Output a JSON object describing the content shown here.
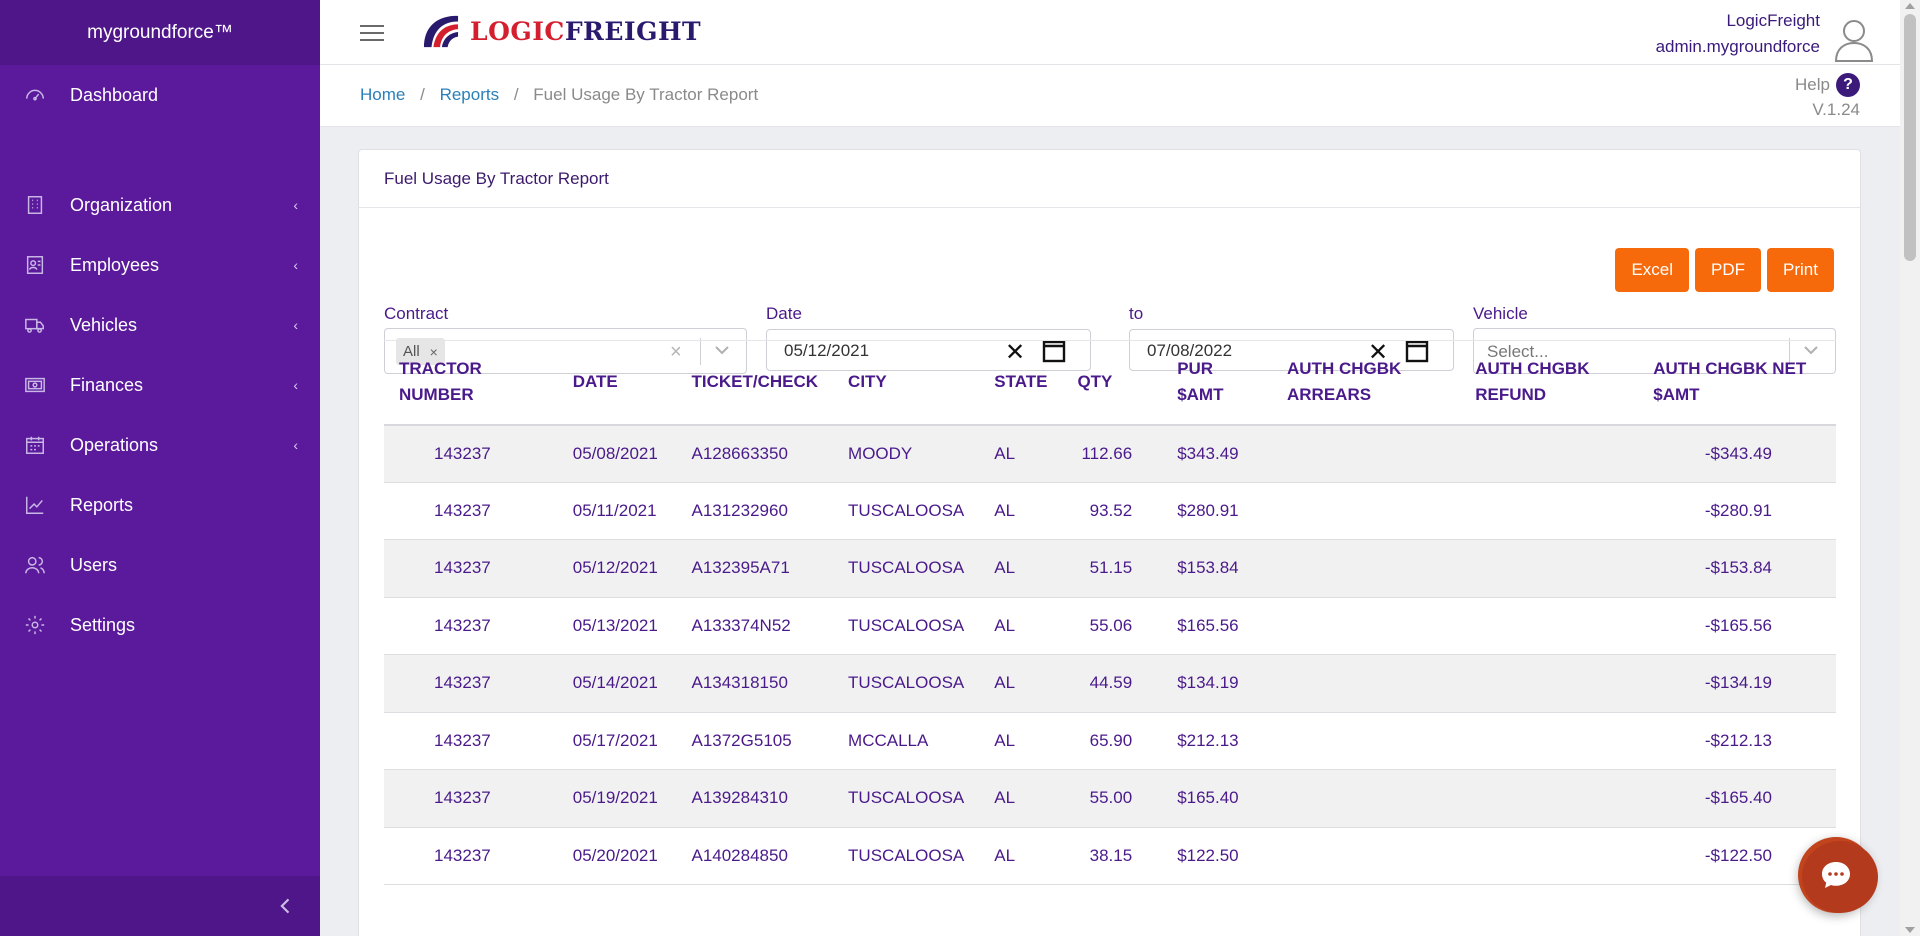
{
  "sidebar": {
    "brand": "mygroundforce™",
    "items": [
      {
        "label": "Dashboard",
        "icon": "dashboard-icon",
        "has_submenu": false
      },
      {
        "label": "Organization",
        "icon": "building-icon",
        "has_submenu": true
      },
      {
        "label": "Employees",
        "icon": "employee-badge-icon",
        "has_submenu": true
      },
      {
        "label": "Vehicles",
        "icon": "truck-icon",
        "has_submenu": true
      },
      {
        "label": "Finances",
        "icon": "money-icon",
        "has_submenu": true
      },
      {
        "label": "Operations",
        "icon": "calendar-icon",
        "has_submenu": true
      },
      {
        "label": "Reports",
        "icon": "chart-line-icon",
        "has_submenu": false
      },
      {
        "label": "Users",
        "icon": "users-icon",
        "has_submenu": false
      },
      {
        "label": "Settings",
        "icon": "gear-icon",
        "has_submenu": false
      }
    ],
    "chevron": "‹"
  },
  "header": {
    "logo_part1": "LOGIC",
    "logo_part2": "FREIGHT",
    "company": "LogicFreight",
    "username": "admin.mygroundforce"
  },
  "breadcrumb": {
    "home": "Home",
    "reports": "Reports",
    "current": "Fuel Usage By Tractor Report",
    "separator": "/"
  },
  "help": {
    "label": "Help",
    "icon": "?",
    "version": "V.1.24"
  },
  "card": {
    "title": "Fuel Usage By Tractor Report"
  },
  "export_buttons": {
    "excel": "Excel",
    "pdf": "PDF",
    "print": "Print"
  },
  "filters": {
    "contract_label": "Contract",
    "contract_tag": "All",
    "contract_tag_remove": "×",
    "clear": "×",
    "date_label": "Date",
    "date_from": "05/12/2021",
    "to_label": "to",
    "date_to": "07/08/2022",
    "date_clear": "✕",
    "vehicle_label": "Vehicle",
    "vehicle_placeholder": "Select..."
  },
  "table": {
    "columns": [
      {
        "l1": "TRACTOR",
        "l2": "NUMBER"
      },
      {
        "l1": "DATE",
        "l2": ""
      },
      {
        "l1": "TICKET/CHECK",
        "l2": ""
      },
      {
        "l1": "CITY",
        "l2": ""
      },
      {
        "l1": "STATE",
        "l2": ""
      },
      {
        "l1": "QTY",
        "l2": ""
      },
      {
        "l1": "PUR",
        "l2": "$AMT"
      },
      {
        "l1": "AUTH CHGBK",
        "l2": "ARREARS"
      },
      {
        "l1": "AUTH CHGBK",
        "l2": "REFUND"
      },
      {
        "l1": "AUTH CHGBK NET",
        "l2": "$AMT"
      }
    ],
    "rows": [
      [
        "143237",
        "05/08/2021",
        "A128663350",
        "MOODY",
        "AL",
        "112.66",
        "$343.49",
        "",
        "",
        "-$343.49"
      ],
      [
        "143237",
        "05/11/2021",
        "A131232960",
        "TUSCALOOSA",
        "AL",
        "93.52",
        "$280.91",
        "",
        "",
        "-$280.91"
      ],
      [
        "143237",
        "05/12/2021",
        "A132395A71",
        "TUSCALOOSA",
        "AL",
        "51.15",
        "$153.84",
        "",
        "",
        "-$153.84"
      ],
      [
        "143237",
        "05/13/2021",
        "A133374N52",
        "TUSCALOOSA",
        "AL",
        "55.06",
        "$165.56",
        "",
        "",
        "-$165.56"
      ],
      [
        "143237",
        "05/14/2021",
        "A134318150",
        "TUSCALOOSA",
        "AL",
        "44.59",
        "$134.19",
        "",
        "",
        "-$134.19"
      ],
      [
        "143237",
        "05/17/2021",
        "A1372G5105",
        "MCCALLA",
        "AL",
        "65.90",
        "$212.13",
        "",
        "",
        "-$212.13"
      ],
      [
        "143237",
        "05/19/2021",
        "A139284310",
        "TUSCALOOSA",
        "AL",
        "55.00",
        "$165.40",
        "",
        "",
        "-$165.40"
      ],
      [
        "143237",
        "05/20/2021",
        "A140284850",
        "TUSCALOOSA",
        "AL",
        "38.15",
        "$122.50",
        "",
        "",
        "-$122.50"
      ]
    ]
  },
  "colors": {
    "sidebar_bg": "#5b1a9c",
    "accent_text": "#4a1a8a",
    "button_orange": "#f76a0c",
    "link_blue": "#2b7fb8",
    "logo_red": "#d4202e",
    "chat_button": "#b33a1c"
  }
}
